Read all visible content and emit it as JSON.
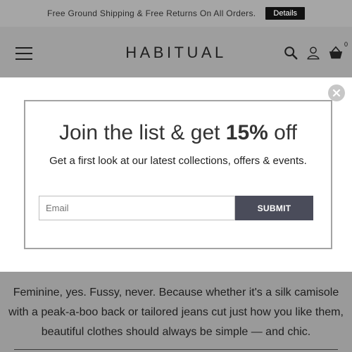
{
  "promo": {
    "text": "Free Ground Shipping & Free Returns On All Orders.",
    "details_label": "Details"
  },
  "header": {
    "logo": "HABITUAL",
    "icons": [
      "menu-icon",
      "search-icon",
      "user-icon",
      "cart-icon"
    ],
    "cart_count": "0"
  },
  "modal": {
    "title_pre": "Join the list & get ",
    "title_strong": "15%",
    "title_post": " off",
    "subtitle": "Get a first look at our latest collections, offers & events.",
    "email_placeholder": "Email",
    "submit_label": "SUBMIT",
    "close_icon": "close-icon"
  },
  "body": {
    "text": "Feminine, yes. Fussy, never. Because whether it's a silk camisole with a peak-a-boo back or tailored jeans cut just how you like them, beautiful clothes should always be simple — and chic."
  },
  "colors": {
    "overlay": "#9a9a9a",
    "submit_bg": "#4a4c5a",
    "details_bg": "#111111"
  }
}
